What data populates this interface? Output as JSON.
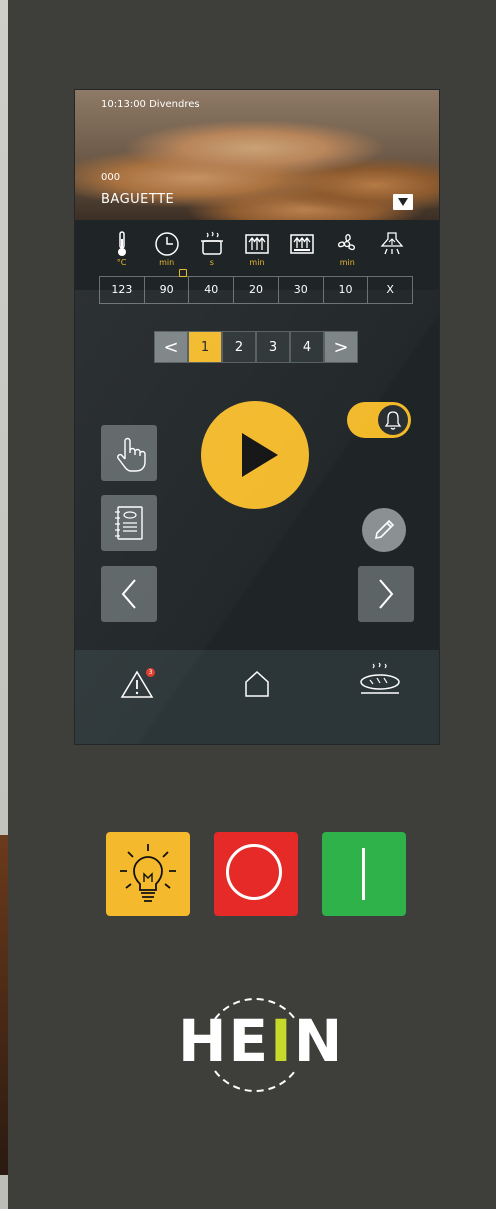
{
  "screen": {
    "header": {
      "time": "10:13:00 Divendres",
      "code": "000",
      "program": "BAGUETTE"
    },
    "params": [
      {
        "icon": "thermometer-icon",
        "unit": "°C",
        "value": "123",
        "marked": false
      },
      {
        "icon": "clock-icon",
        "unit": "min",
        "value": "90",
        "marked": true
      },
      {
        "icon": "steam-pot-icon",
        "unit": "s",
        "value": "40",
        "marked": false
      },
      {
        "icon": "damper-up-icon",
        "unit": "min",
        "value": "20",
        "marked": false
      },
      {
        "icon": "damper-icon",
        "unit": "",
        "value": "30",
        "marked": false
      },
      {
        "icon": "fan-icon",
        "unit": "min",
        "value": "10",
        "marked": false
      },
      {
        "icon": "hood-icon",
        "unit": "",
        "value": "X",
        "marked": false
      }
    ],
    "stepper": {
      "prev": "<",
      "steps": [
        "1",
        "2",
        "3",
        "4"
      ],
      "active_step": "1",
      "next": ">"
    },
    "alarm_toggle": {
      "on": true
    },
    "nav": {
      "alert_badge": "3"
    }
  },
  "hardware": {
    "colors": {
      "light": "#f4b92c",
      "stop": "#e52a27",
      "start": "#2fb24a"
    }
  },
  "logo": {
    "pre": "HE",
    "accent": "I",
    "post": "N"
  }
}
